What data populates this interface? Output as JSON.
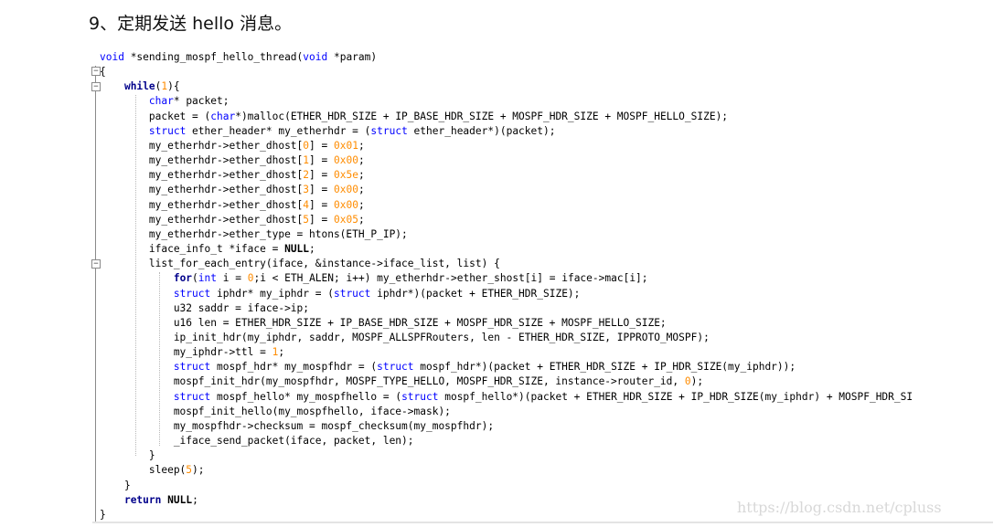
{
  "heading": "9、定期发送 hello 消息。",
  "code_lines": [
    "void *sending_mospf_hello_thread(void *param)",
    "{",
    "    while(1){",
    "        char* packet;",
    "        packet = (char*)malloc(ETHER_HDR_SIZE + IP_BASE_HDR_SIZE + MOSPF_HDR_SIZE + MOSPF_HELLO_SIZE);",
    "        struct ether_header* my_etherhdr = (struct ether_header*)(packet);",
    "        my_etherhdr->ether_dhost[0] = 0x01;",
    "        my_etherhdr->ether_dhost[1] = 0x00;",
    "        my_etherhdr->ether_dhost[2] = 0x5e;",
    "        my_etherhdr->ether_dhost[3] = 0x00;",
    "        my_etherhdr->ether_dhost[4] = 0x00;",
    "        my_etherhdr->ether_dhost[5] = 0x05;",
    "        my_etherhdr->ether_type = htons(ETH_P_IP);",
    "        iface_info_t *iface = NULL;",
    "        list_for_each_entry(iface, &instance->iface_list, list) {",
    "            for(int i = 0;i < ETH_ALEN; i++) my_etherhdr->ether_shost[i] = iface->mac[i];",
    "            struct iphdr* my_iphdr = (struct iphdr*)(packet + ETHER_HDR_SIZE);",
    "            u32 saddr = iface->ip;",
    "            u16 len = ETHER_HDR_SIZE + IP_BASE_HDR_SIZE + MOSPF_HDR_SIZE + MOSPF_HELLO_SIZE;",
    "            ip_init_hdr(my_iphdr, saddr, MOSPF_ALLSPFRouters, len - ETHER_HDR_SIZE, IPPROTO_MOSPF);",
    "            my_iphdr->ttl = 1;",
    "            struct mospf_hdr* my_mospfhdr = (struct mospf_hdr*)(packet + ETHER_HDR_SIZE + IP_HDR_SIZE(my_iphdr));",
    "            mospf_init_hdr(my_mospfhdr, MOSPF_TYPE_HELLO, MOSPF_HDR_SIZE, instance->router_id, 0);",
    "            struct mospf_hello* my_mospfhello = (struct mospf_hello*)(packet + ETHER_HDR_SIZE + IP_HDR_SIZE(my_iphdr) + MOSPF_HDR_SIZE);",
    "            mospf_init_hello(my_mospfhello, iface->mask);",
    "            my_mospfhdr->checksum = mospf_checksum(my_mospfhdr);",
    "            _iface_send_packet(iface, packet, len);",
    "        }",
    "        sleep(5);",
    "    }",
    "    return NULL;",
    "}"
  ],
  "watermark": "https://blog.csdn.net/cpluss",
  "colors": {
    "keyword": "#0000ff",
    "control_keyword": "#00008b",
    "number": "#ff8c00",
    "text": "#000000"
  }
}
